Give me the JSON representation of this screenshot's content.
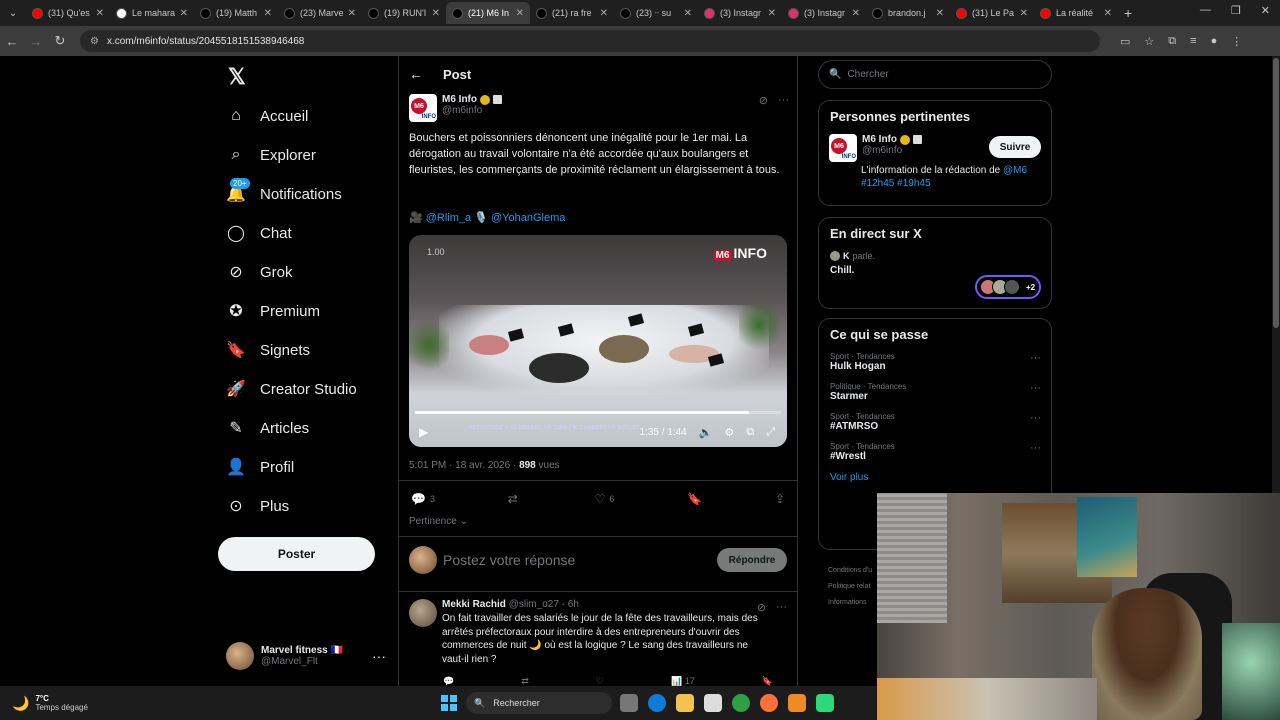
{
  "browser": {
    "tabs": [
      {
        "title": "(31) Qu'es",
        "icon": "youtube-icon",
        "color": "#ff0000"
      },
      {
        "title": "Le mahara",
        "icon": "google-icon",
        "color": "#ffffff"
      },
      {
        "title": "(19) Matth",
        "icon": "x-icon",
        "color": "#000000"
      },
      {
        "title": "(23) Marve",
        "icon": "x-icon",
        "color": "#000000"
      },
      {
        "title": "(19) RUN'I",
        "icon": "x-icon",
        "color": "#000000"
      },
      {
        "title": "(21) M6 In",
        "icon": "x-icon",
        "color": "#000000",
        "active": true
      },
      {
        "title": "(21) ra fre",
        "icon": "x-icon",
        "color": "#000000"
      },
      {
        "title": "(23) ᐧᐧ su",
        "icon": "x-icon",
        "color": "#000000"
      },
      {
        "title": "(3) Instagr",
        "icon": "instagram-icon",
        "color": "#e1306c"
      },
      {
        "title": "(3) Instagr",
        "icon": "instagram-icon",
        "color": "#e1306c"
      },
      {
        "title": "brandon.j",
        "icon": "tiktok-icon",
        "color": "#000000"
      },
      {
        "title": "(31) Le Pa",
        "icon": "youtube-icon",
        "color": "#ff0000"
      },
      {
        "title": "La réalité",
        "icon": "youtube-icon",
        "color": "#ff0000"
      }
    ],
    "url": "x.com/m6info/status/2045518151538946468"
  },
  "sidebar": {
    "items": [
      {
        "label": "Accueil",
        "icon": "home-icon"
      },
      {
        "label": "Explorer",
        "icon": "search-icon"
      },
      {
        "label": "Notifications",
        "icon": "bell-icon",
        "badge": "20+"
      },
      {
        "label": "Chat",
        "icon": "chat-icon"
      },
      {
        "label": "Grok",
        "icon": "grok-icon"
      },
      {
        "label": "Premium",
        "icon": "premium-icon"
      },
      {
        "label": "Signets",
        "icon": "bookmark-icon"
      },
      {
        "label": "Creator Studio",
        "icon": "rocket-icon"
      },
      {
        "label": "Articles",
        "icon": "article-icon"
      },
      {
        "label": "Profil",
        "icon": "person-icon"
      },
      {
        "label": "Plus",
        "icon": "more-circle-icon"
      }
    ],
    "post_button": "Poster",
    "profile": {
      "name": "Marvel fitness 🇫🇷",
      "handle": "@Marvel_Flt"
    }
  },
  "main": {
    "header": "Post",
    "author": {
      "name": "M6 Info",
      "handle": "@m6info"
    },
    "text": "Bouchers et poissonniers dénoncent une inégalité pour le 1er mai. La dérogation au travail volontaire n'a été accordée qu'aux boulangers et fleuristes, les commerçants de proximité réclament un élargissement à tous.",
    "credits": {
      "cam": "🎥",
      "user1": "@Rlim_a",
      "mic": "🎙️",
      "user2": "@YohanGlema"
    },
    "video": {
      "speed": "1.00",
      "brand": "INFO",
      "brand_prefix": "M6",
      "credit": "REPORTAGE Y. GLEMAREC / R. LIMA / N. LAMBERT / P. ROLLET",
      "time": "1:35 / 1:44",
      "progress": 0.913
    },
    "meta": {
      "time": "5:01 PM · 18 avr. 2026 · ",
      "views": "898",
      "views_label": " vues"
    },
    "engagement": {
      "replies": "3",
      "reposts": "",
      "likes": "6"
    },
    "sort": "Pertinence ⌄",
    "reply_placeholder": "Postez votre réponse",
    "reply_button": "Répondre",
    "reply": {
      "name": "Mekki Rachid",
      "handle": "@slim_o27 · 6h",
      "text": "On fait travailler des salariés le jour de la fête des travailleurs, mais des arrêtés préfectoraux pour interdire à des entrepreneurs d'ouvrir des commerces de nuit 🌙 où est la logique ? Le sang des travailleurs ne vaut-il rien ?",
      "views": "17"
    }
  },
  "right": {
    "search_placeholder": "Chercher",
    "relevant": {
      "title": "Personnes pertinentes",
      "name": "M6 Info",
      "handle": "@m6info",
      "follow": "Suivre",
      "bio": "L'information de la rédaction de ",
      "bio_link": "@M6 #12h45 #19h45"
    },
    "live": {
      "title": "En direct sur X",
      "speaker": "K",
      "speaker_suffix": "parle.",
      "room": "Chill.",
      "more": "+2"
    },
    "trends": {
      "title": "Ce qui se passe",
      "items": [
        {
          "category": "Sport · Tendances",
          "name": "Hulk Hogan"
        },
        {
          "category": "Politique · Tendances",
          "name": "Starmer"
        },
        {
          "category": "Sport · Tendances",
          "name": "#ATMRSO"
        },
        {
          "category": "Sport · Tendances",
          "name": "#Wrestl"
        }
      ],
      "see_more": "Voir plus"
    },
    "footer": [
      "Conditions d'u",
      "Politique relat",
      "Informations"
    ]
  },
  "taskbar": {
    "temp": "7°C",
    "condition": "Temps dégagé",
    "search": "Rechercher"
  }
}
